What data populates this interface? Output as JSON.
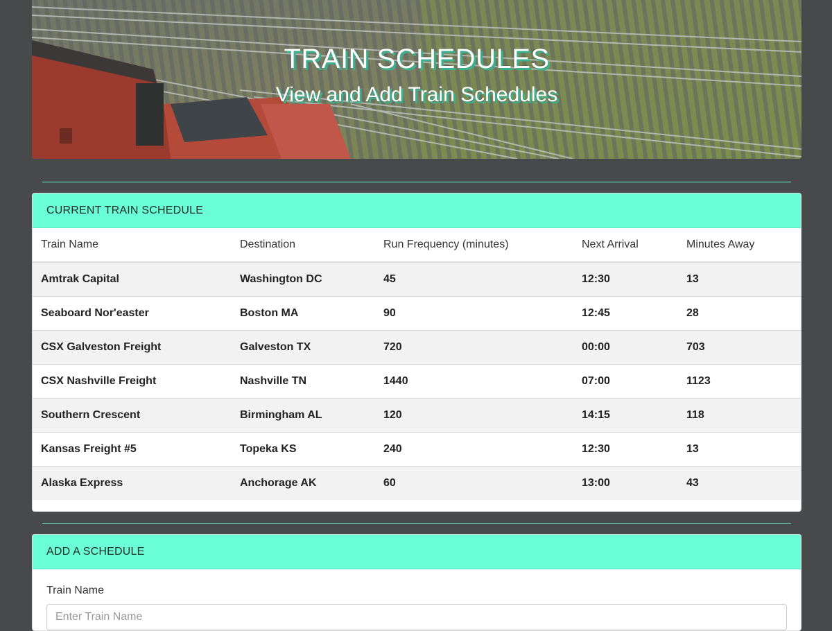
{
  "header": {
    "title": "TRAIN SCHEDULES",
    "subtitle": "View and Add Train Schedules"
  },
  "schedule": {
    "heading": "CURRENT TRAIN SCHEDULE",
    "columns": [
      "Train Name",
      "Destination",
      "Run Frequency (minutes)",
      "Next Arrival",
      "Minutes Away"
    ],
    "rows": [
      [
        "Amtrak Capital",
        "Washington DC",
        "45",
        "12:30",
        "13"
      ],
      [
        "Seaboard Nor'easter",
        "Boston MA",
        "90",
        "12:45",
        "28"
      ],
      [
        "CSX Galveston Freight",
        "Galveston TX",
        "720",
        "00:00",
        "703"
      ],
      [
        "CSX Nashville Freight",
        "Nashville TN",
        "1440",
        "07:00",
        "1123"
      ],
      [
        "Southern Crescent",
        "Birmingham AL",
        "120",
        "14:15",
        "118"
      ],
      [
        "Kansas Freight #5",
        "Topeka KS",
        "240",
        "12:30",
        "13"
      ],
      [
        "Alaska Express",
        "Anchorage AK",
        "60",
        "13:00",
        "43"
      ]
    ]
  },
  "add_form": {
    "heading": "ADD A SCHEDULE",
    "train_name_label": "Train Name",
    "train_name_placeholder": "Enter Train Name",
    "train_name_value": ""
  },
  "colors": {
    "accent": "#6affd6",
    "page_bg": "#47494b",
    "title_shadow": "#3bb08f"
  }
}
